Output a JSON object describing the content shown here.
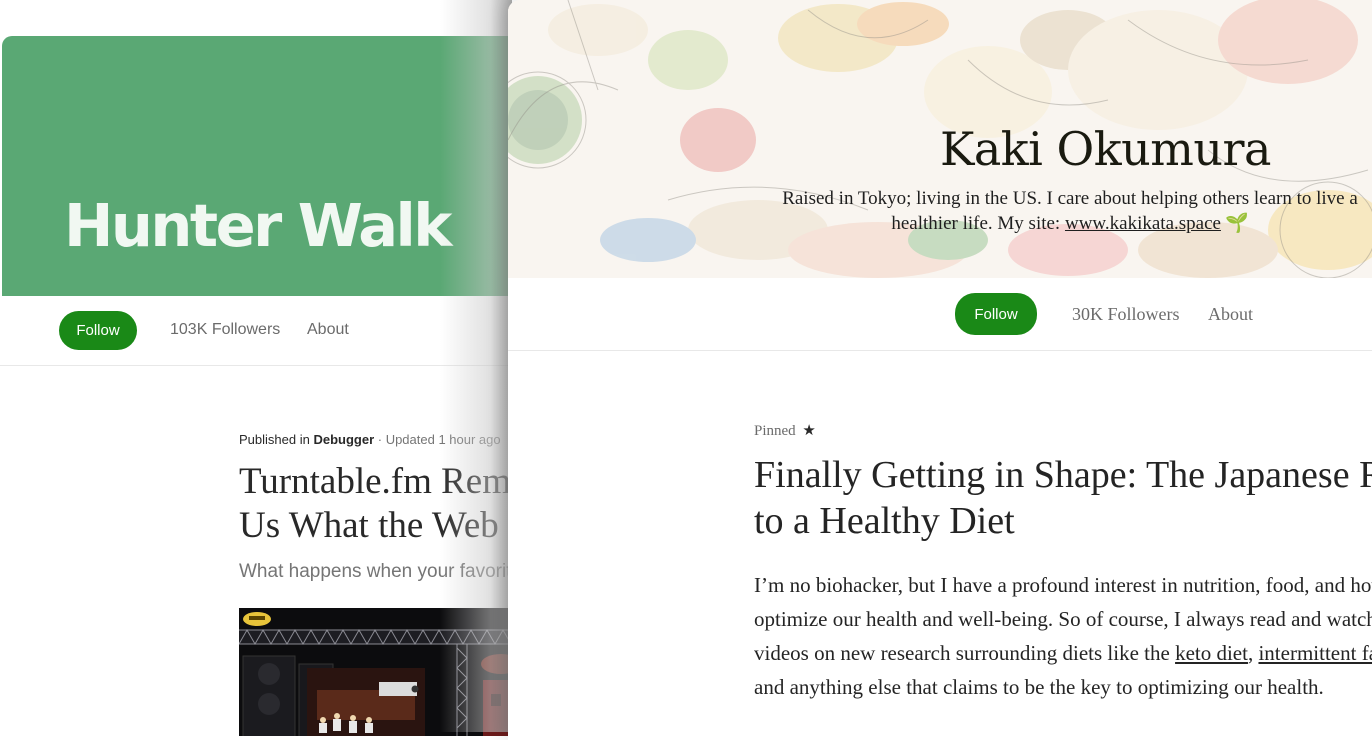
{
  "back_profile": {
    "name": "Hunter Walk",
    "colors": {
      "header_bg": "#5aa874",
      "follow_bg": "#1a8917"
    },
    "nav": {
      "follow_label": "Follow",
      "followers": "103K Followers",
      "about": "About"
    },
    "story": {
      "published_prefix": "Published in",
      "publication": "Debugger",
      "updated": "· Updated 1 hour ago",
      "headline": "Turntable.fm Reminds Us What the Web Can Be",
      "subtitle": "What happens when your favorite",
      "image_icon": "turntable-logo-icon"
    }
  },
  "front_profile": {
    "name": "Kaki Okumura",
    "bio_text": "Raised in Tokyo; living in the US. I care about helping others learn to live a healthier life. My site: ",
    "bio_link": "www.kakikata.space",
    "bio_icon": "🌱",
    "nav": {
      "follow_label": "Follow",
      "followers": "30K Followers",
      "about": "About"
    },
    "pinned_label": "Pinned",
    "pinned_icon": "★",
    "headline": "Finally Getting in Shape: The Japanese Rules to a Healthy Diet",
    "body": {
      "p1": "I’m no biohacker, but I have a profound interest in nutrition, food, and how we can optimize our health and well-being. So of course, I always read and watch a lot of videos on new research surrounding diets like the ",
      "link_keto": "keto diet",
      "sep": ", ",
      "link_if": "intermittent fasting",
      "p2": ", paleo, and anything else that claims to be the key to optimizing our health."
    }
  }
}
